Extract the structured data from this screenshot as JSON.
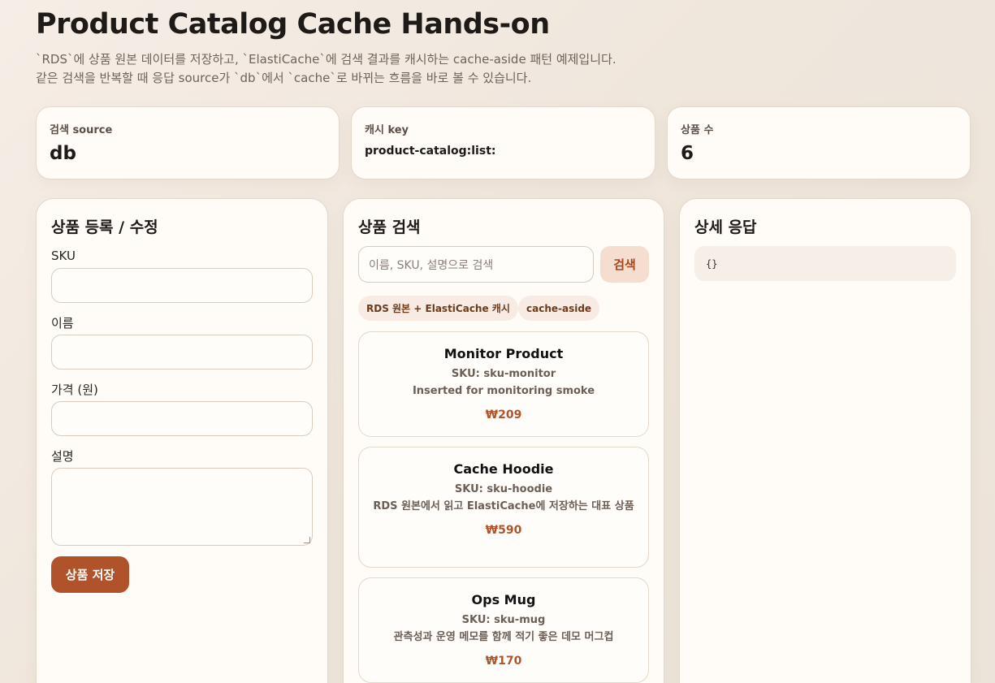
{
  "header": {
    "title": "Product Catalog Cache Hands-on",
    "desc_line1": "`RDS`에 상품 원본 데이터를 저장하고, `ElastiCache`에 검색 결과를 캐시하는 cache-aside 패턴 예제입니다.",
    "desc_line2": "같은 검색을 반복할 때 응답 source가 `db`에서 `cache`로 바뀌는 흐름을 바로 볼 수 있습니다."
  },
  "stats": [
    {
      "label": "검색 source",
      "value": "db"
    },
    {
      "label": "캐시 key",
      "value": "product-catalog:list:"
    },
    {
      "label": "상품 수",
      "value": "6"
    }
  ],
  "form": {
    "title": "상품 등록 / 수정",
    "sku_label": "SKU",
    "sku_value": "",
    "name_label": "이름",
    "name_value": "",
    "price_label": "가격 (원)",
    "price_value": "",
    "desc_label": "설명",
    "desc_value": "",
    "save_label": "상품 저장"
  },
  "search": {
    "title": "상품 검색",
    "placeholder": "이름, SKU, 설명으로 검색",
    "button_label": "검색",
    "chips": [
      "RDS 원본 + ElastiCache 캐시",
      "cache-aside"
    ],
    "products": [
      {
        "name": "Monitor Product",
        "sku": "SKU: sku-monitor",
        "desc": "Inserted for monitoring smoke",
        "price": "₩209"
      },
      {
        "name": "Cache Hoodie",
        "sku": "SKU: sku-hoodie",
        "desc": "RDS 원본에서 읽고 ElastiCache에 저장하는 대표 상품",
        "price": "₩590"
      },
      {
        "name": "Ops Mug",
        "sku": "SKU: sku-mug",
        "desc": "관측성과 운영 메모를 함께 적기 좋은 데모 머그컵",
        "price": "₩170"
      }
    ]
  },
  "detail": {
    "title": "상세 응답",
    "body": "{}"
  },
  "colors": {
    "accent": "#b1532a",
    "accent_soft": "#f5ddd0",
    "panel": "#fffcf8",
    "border": "#e3d8cc"
  }
}
